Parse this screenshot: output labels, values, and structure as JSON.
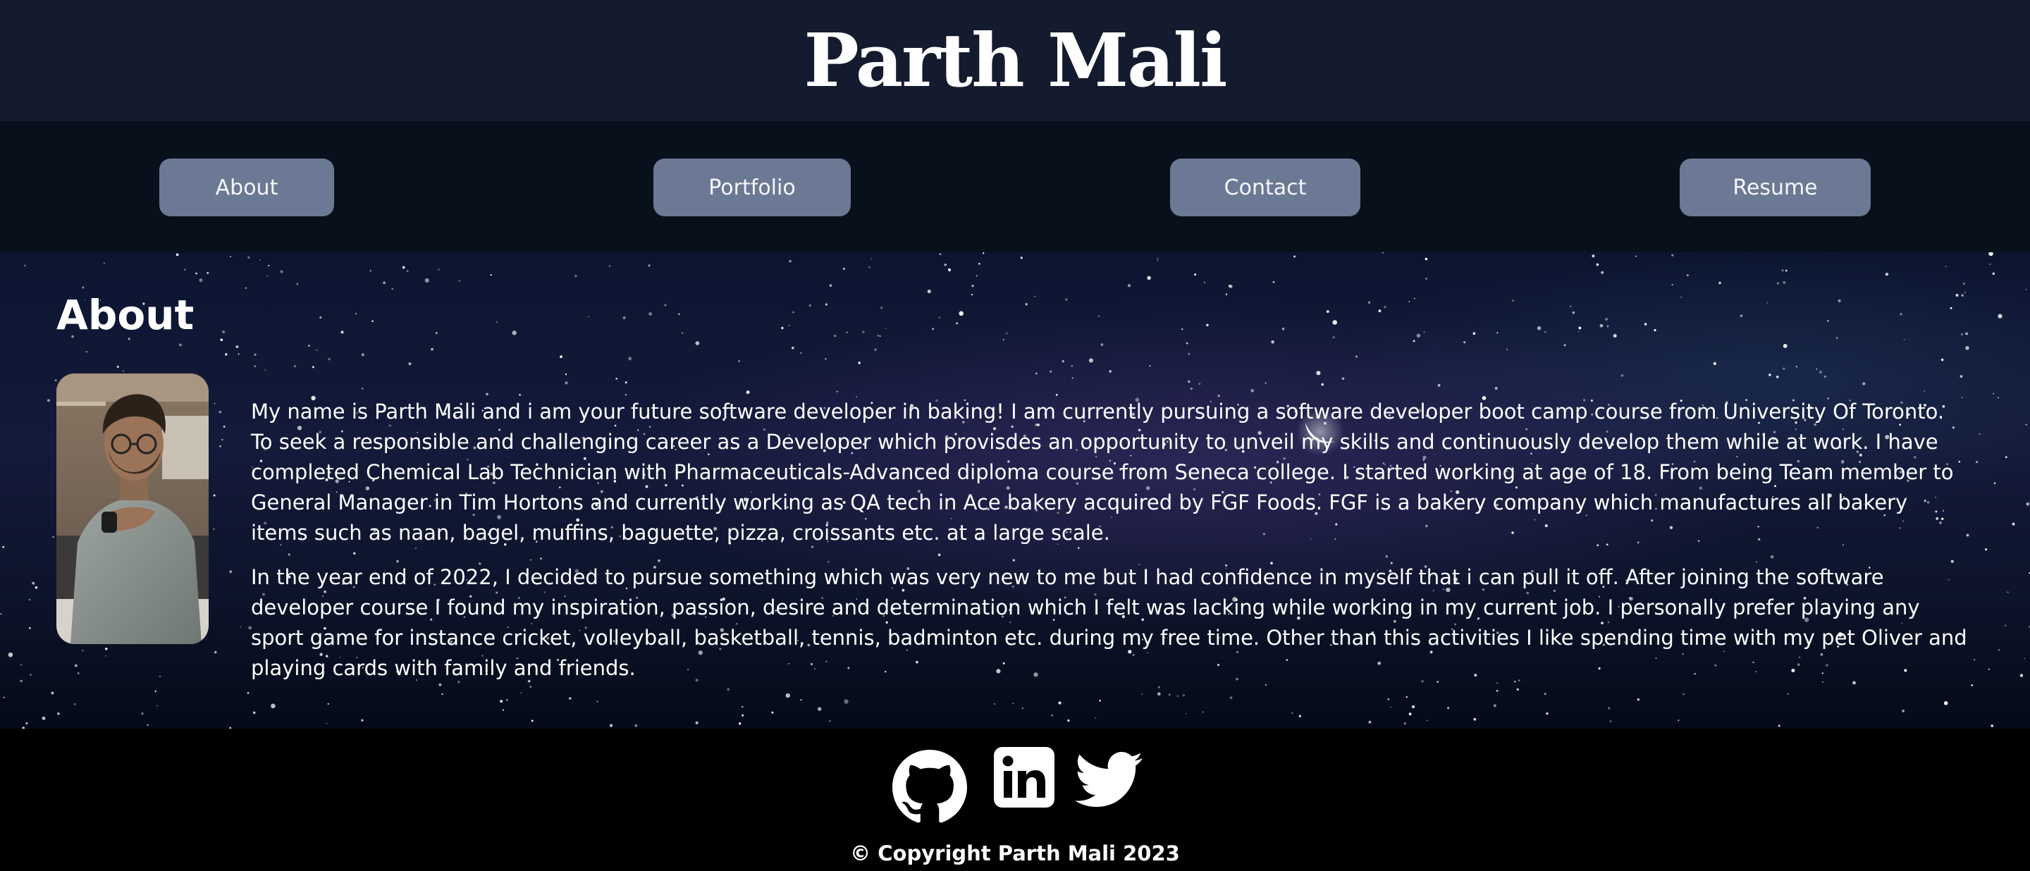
{
  "header": {
    "title": "Parth Mali"
  },
  "nav": {
    "items": [
      {
        "label": "About"
      },
      {
        "label": "Portfolio"
      },
      {
        "label": "Contact"
      },
      {
        "label": "Resume"
      }
    ]
  },
  "about": {
    "heading": "About",
    "paragraphs": [
      "My name is Parth Mali and i am your future software developer in baking! I am currently pursuing a software developer boot camp course from University Of Toronto. To seek a responsible and challenging career as a Developer which provisdes an opportunity to unveil my skills and continuously develop them while at work. I have completed Chemical Lab Technician with Pharmaceuticals-Advanced diploma course from Seneca college. I started working at age of 18. From being Team member to General Manager in Tim Hortons and currently working as QA tech in Ace bakery acquired by FGF Foods. FGF is a bakery company which manufactures all bakery items such as naan, bagel, muffins, baguette, pizza, croissants etc. at a large scale.",
      "In the year end of 2022, I decided to pursue something which was very new to me but I had confidence in myself that i can pull it off. After joining the software developer course I found my inspiration, passion, desire and determination which I felt was lacking while working in my current job. I personally prefer playing any sport game for instance cricket, volleyball, basketball, tennis, badminton etc. during my free time. Other than this activities I like spending time with my pet Oliver and playing cards with family and friends."
    ]
  },
  "footer": {
    "social": [
      {
        "icon": "github-icon"
      },
      {
        "icon": "linkedin-icon"
      },
      {
        "icon": "twitter-icon"
      }
    ],
    "copyright": "© Copyright Parth Mali 2023"
  },
  "colors": {
    "header_bg": "#141b2e",
    "nav_bg": "#08101b",
    "nav_button": "#6b7994",
    "footer_bg": "#000000"
  }
}
